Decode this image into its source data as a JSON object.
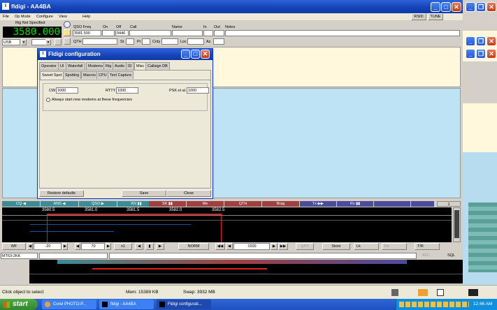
{
  "main": {
    "title": "fldigi - AA4BA",
    "menu": [
      "File",
      "Op Mode",
      "Configure",
      "View",
      "Help"
    ],
    "rsid": "RSID",
    "tune": "TUNE",
    "rig": "Rig Not Specified",
    "freq": "3580.000",
    "mode": "USB",
    "hdr": {
      "qsd": "QSO Freq",
      "on": "On",
      "off": "Off",
      "call": "Call",
      "name": "Name",
      "in": "In",
      "out": "Out",
      "notes": "Notes"
    },
    "qsofreq": "3581.500",
    "offtime": "0446",
    "qth": "QTH",
    "st": "St",
    "pr": "Pr",
    "cnty": "Cnty",
    "loc": "Loc",
    "az": "Az"
  },
  "config": {
    "title": "Fldigi configuration",
    "tabs": [
      "Operator",
      "UI",
      "Waterfall",
      "Modems",
      "Rig",
      "Audio",
      "ID",
      "Misc",
      "Callsign DB"
    ],
    "subtabs": [
      "Sweet Spot",
      "Spotting",
      "Macros",
      "CPU",
      "Text Capture"
    ],
    "cw_label": "CW",
    "cw_value": "1000",
    "rtty_label": "RTTY",
    "rtty_value": "1000",
    "psk_label": "PSK et al.",
    "psk_value": "1000",
    "always_label": "Always start new modems at these frequencies",
    "restore": "Restore defaults",
    "save": "Save",
    "close": "Close"
  },
  "macros": [
    {
      "label": "CQ ◀",
      "color": "#3c8c96"
    },
    {
      "label": "ANS ◀",
      "color": "#3c8c96"
    },
    {
      "label": "QSO ▶",
      "color": "#3c8c96"
    },
    {
      "label": "KN ▮▮",
      "color": "#3c8c96"
    },
    {
      "label": "SK ▮▮",
      "color": "#a04040"
    },
    {
      "label": "Me",
      "color": "#a04040"
    },
    {
      "label": "QTH",
      "color": "#a04040"
    },
    {
      "label": "Brag",
      "color": "#a04040"
    },
    {
      "label": "Tx ▶▶",
      "color": "#4c4c9c"
    },
    {
      "label": "Rx ▮▮",
      "color": "#4c4c9c"
    },
    {
      "label": "",
      "color": "#4c4c9c"
    },
    {
      "label": "",
      "color": "#4c4c9c"
    }
  ],
  "macro_page": "1",
  "scale": [
    "3580.5",
    "3581.0",
    "3581.5",
    "3582.0",
    "3582.5"
  ],
  "wfbar": {
    "wf": "WF",
    "ref": "-20",
    "range": "70",
    "zoom": "x1",
    "norm": "NORM",
    "carrier": "1500",
    "qsy": "QSY",
    "store": "Store",
    "lk": "Lk",
    "rv": "Rv",
    "tr": "T/R"
  },
  "status": {
    "mode": "MT63-2KK",
    "afc": "AFC",
    "sql": "SQL"
  },
  "app_status": {
    "hint": "Click object to select",
    "mem": "Mem: 15389 KB",
    "swap": "Swap: 3932 MB"
  },
  "taskbar": {
    "start": "start",
    "tasks": [
      "Corel PHOTO-P...",
      "fldigi - AA4BA",
      "Fldigi configurati..."
    ],
    "clock": "12:46 AM"
  }
}
